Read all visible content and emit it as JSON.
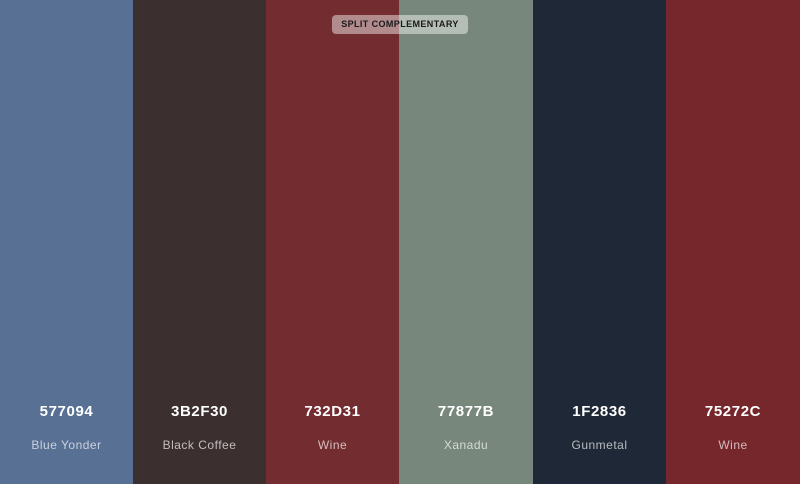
{
  "scheme_label": "SPLIT COMPLEMENTARY",
  "swatches": [
    {
      "hex": "577094",
      "name": "Blue Yonder",
      "color": "#577094"
    },
    {
      "hex": "3B2F30",
      "name": "Black Coffee",
      "color": "#3B2F30"
    },
    {
      "hex": "732D31",
      "name": "Wine",
      "color": "#732D31"
    },
    {
      "hex": "77877B",
      "name": "Xanadu",
      "color": "#77877B"
    },
    {
      "hex": "1F2836",
      "name": "Gunmetal",
      "color": "#1F2836"
    },
    {
      "hex": "75272C",
      "name": "Wine",
      "color": "#75272C"
    }
  ]
}
